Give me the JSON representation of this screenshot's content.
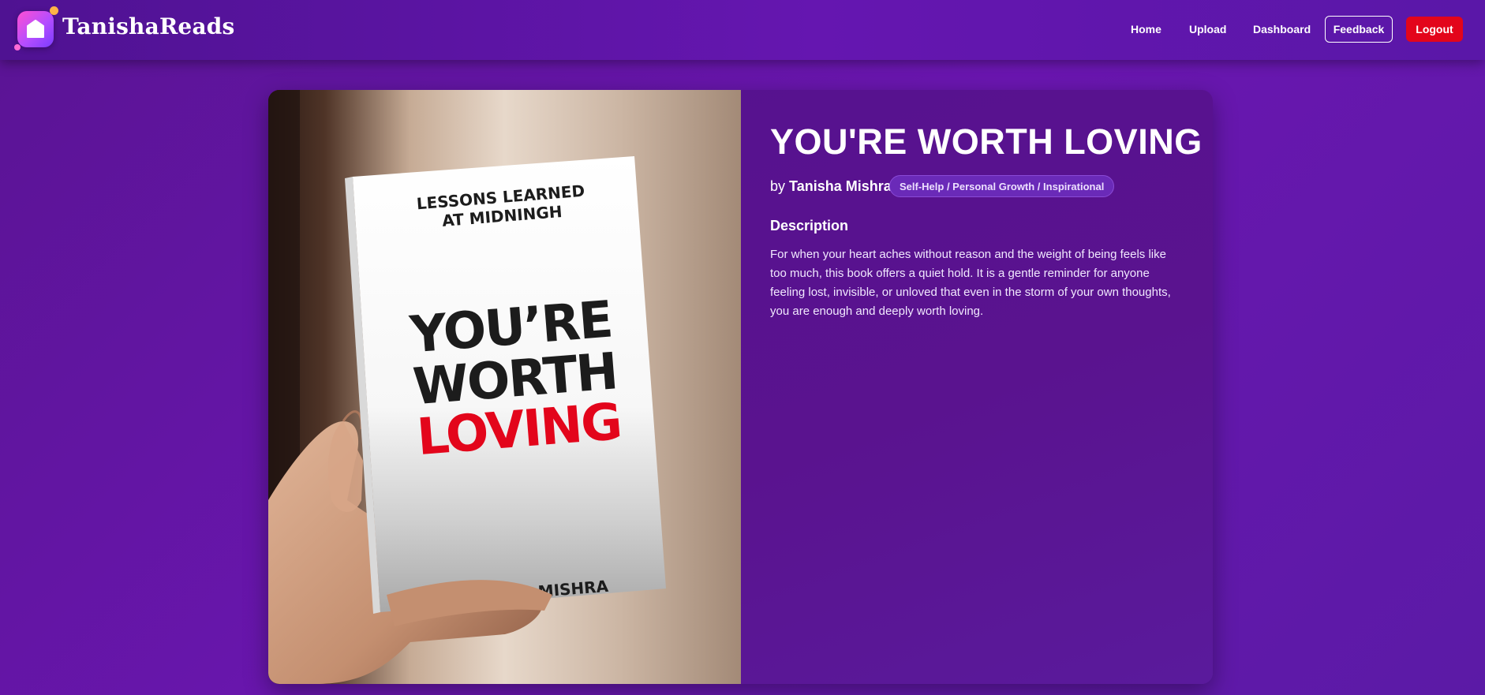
{
  "app": {
    "brand": "TanishaReads",
    "nav": {
      "home": "Home",
      "upload": "Upload",
      "dashboard": "Dashboard",
      "feedback": "Feedback",
      "logout": "Logout"
    }
  },
  "book": {
    "title": "YOU'RE WORTH LOVING",
    "by_prefix": "by",
    "author": "Tanisha Mishra",
    "genre": "Self-Help / Personal Growth / Inspirational",
    "description_heading": "Description",
    "description": "For when your heart aches without reason and the weight of being feels like too much, this book offers a quiet hold. It is a gentle reminder for anyone feeling lost, invisible, or unloved that even in the storm of your own thoughts, you are enough and deeply worth loving.",
    "cover": {
      "series_line_1": "LESSONS LEARNED",
      "series_line_2": "AT MIDNINGH",
      "title_line_1": "YOU’RE",
      "title_line_2": "WORTH",
      "title_line_3": "LOVING",
      "author": "TANISHA MISHRA"
    }
  },
  "colors": {
    "accent_red": "#e3051b",
    "page_purple": "#6a16b0"
  }
}
